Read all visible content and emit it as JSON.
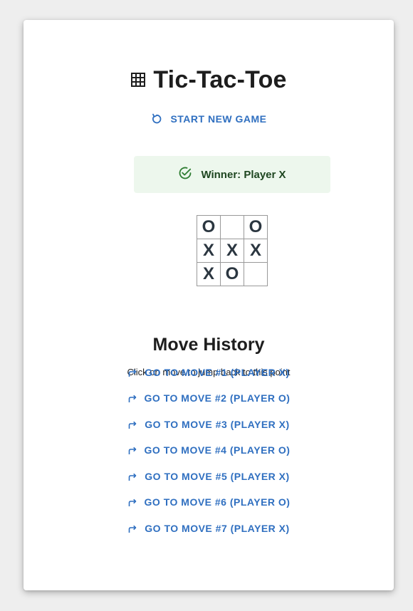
{
  "app": {
    "title": "Tic-Tac-Toe",
    "title_icon": "grid-icon",
    "new_game_label": "START NEW GAME",
    "new_game_icon": "refresh-icon",
    "accent_color": "#2f6fc0"
  },
  "status": {
    "text": "Winner: Player X",
    "icon": "check-circle-icon",
    "background": "#edf7ed",
    "color": "#1e4620"
  },
  "board": {
    "cells": [
      "O",
      "",
      "O",
      "X",
      "X",
      "X",
      "X",
      "O",
      ""
    ]
  },
  "history": {
    "title": "Move History",
    "hint": "Click on move to jump back to this point",
    "move_icon": "redo-arrow-icon",
    "moves": [
      "GO TO MOVE #1 (PLAYER X)",
      "GO TO MOVE #2 (PLAYER O)",
      "GO TO MOVE #3 (PLAYER X)",
      "GO TO MOVE #4 (PLAYER O)",
      "GO TO MOVE #5 (PLAYER X)",
      "GO TO MOVE #6 (PLAYER O)",
      "GO TO MOVE #7 (PLAYER X)"
    ]
  }
}
